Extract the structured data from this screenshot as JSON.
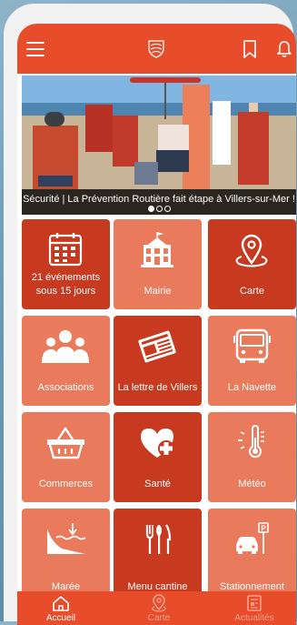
{
  "banner": {
    "caption": "Sécurité | La Prévention Routière fait étape à Villers-sur-Mer !",
    "slides": 3,
    "active_slide": 1
  },
  "tiles": [
    {
      "label": "21 événements sous 15 jours",
      "icon": "calendar-icon",
      "shade": "dark"
    },
    {
      "label": "Mairie",
      "icon": "town-hall-icon",
      "shade": "light"
    },
    {
      "label": "Carte",
      "icon": "map-pin-icon",
      "shade": "dark"
    },
    {
      "label": "Associations",
      "icon": "people-icon",
      "shade": "light"
    },
    {
      "label": "La lettre de Villers",
      "icon": "newspaper-icon",
      "shade": "dark"
    },
    {
      "label": "La Navette",
      "icon": "bus-icon",
      "shade": "light"
    },
    {
      "label": "Commerces",
      "icon": "basket-icon",
      "shade": "light"
    },
    {
      "label": "Santé",
      "icon": "heart-plus-icon",
      "shade": "dark"
    },
    {
      "label": "Météo",
      "icon": "thermometer-icon",
      "shade": "light"
    },
    {
      "label": "Marée",
      "icon": "tide-icon",
      "shade": "light"
    },
    {
      "label": "Menu cantine",
      "icon": "fork-knife-icon",
      "shade": "dark"
    },
    {
      "label": "Stationnement",
      "icon": "parking-car-icon",
      "shade": "light"
    }
  ],
  "nav": [
    {
      "label": "Accueil",
      "icon": "home-icon",
      "active": true
    },
    {
      "label": "Carte",
      "icon": "map-pin-icon",
      "active": false
    },
    {
      "label": "Actualités",
      "icon": "news-icon",
      "active": false
    }
  ],
  "colors": {
    "brand": "#e74c2b",
    "tile_dark": "#c73a20",
    "tile_light": "#ea7a5c",
    "nav_inactive": "#f3a08a"
  }
}
